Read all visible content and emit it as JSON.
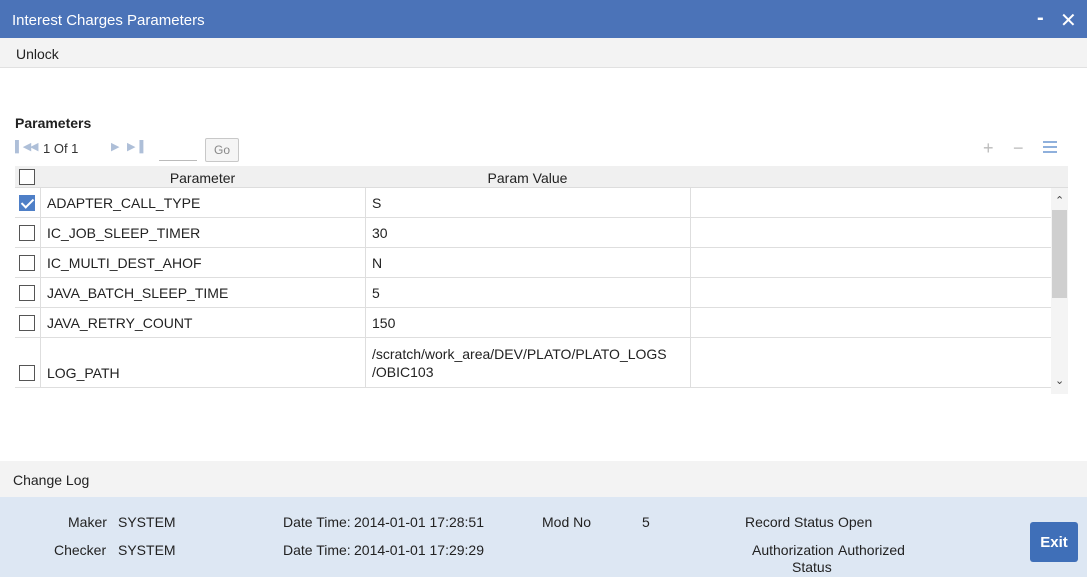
{
  "window": {
    "title": "Interest Charges Parameters",
    "minimize_label": "-",
    "close_label": "✕"
  },
  "menu": {
    "unlock_label": "Unlock"
  },
  "parameters": {
    "section_title": "Parameters",
    "pager": {
      "first_icon": "first-page-icon",
      "prev_icon": "prev-page-icon",
      "next_icon": "next-page-icon",
      "last_icon": "last-page-icon",
      "page_text": "1 Of 1",
      "page_input_value": "",
      "go_label": "Go",
      "add_label": "+",
      "delete_label": "−"
    },
    "columns": {
      "parameter": "Parameter",
      "param_value": "Param Value"
    },
    "header_checkbox_checked": false,
    "rows": [
      {
        "checked": true,
        "parameter": "ADAPTER_CALL_TYPE",
        "value": "S"
      },
      {
        "checked": false,
        "parameter": "IC_JOB_SLEEP_TIMER",
        "value": "30"
      },
      {
        "checked": false,
        "parameter": "IC_MULTI_DEST_AHOF",
        "value": "N"
      },
      {
        "checked": false,
        "parameter": "JAVA_BATCH_SLEEP_TIME",
        "value": "5"
      },
      {
        "checked": false,
        "parameter": "JAVA_RETRY_COUNT",
        "value": "150"
      },
      {
        "checked": false,
        "parameter": "LOG_PATH",
        "value_line1": "/scratch/work_area/DEV/PLATO/PLATO_LOGS",
        "value_line2": "/OBIC103"
      }
    ]
  },
  "change_log": {
    "label": "Change Log"
  },
  "footer": {
    "maker_label": "Maker",
    "maker_value": "SYSTEM",
    "maker_datetime_label": "Date Time:",
    "maker_datetime_value": "2014-01-01 17:28:51",
    "checker_label": "Checker",
    "checker_value": "SYSTEM",
    "checker_datetime_label": "Date Time:",
    "checker_datetime_value": "2014-01-01 17:29:29",
    "mod_no_label": "Mod No",
    "mod_no_value": "5",
    "record_status_label": "Record Status",
    "record_status_value": "Open",
    "auth_status_label_1": "Authorization",
    "auth_status_label_2": "Status",
    "auth_status_value": "Authorized",
    "exit_label": "Exit"
  },
  "colors": {
    "titlebar": "#4b73b8",
    "footer_bg": "#dde7f3",
    "exit_button": "#3f6fb8",
    "checked_box": "#4e7fc7"
  }
}
